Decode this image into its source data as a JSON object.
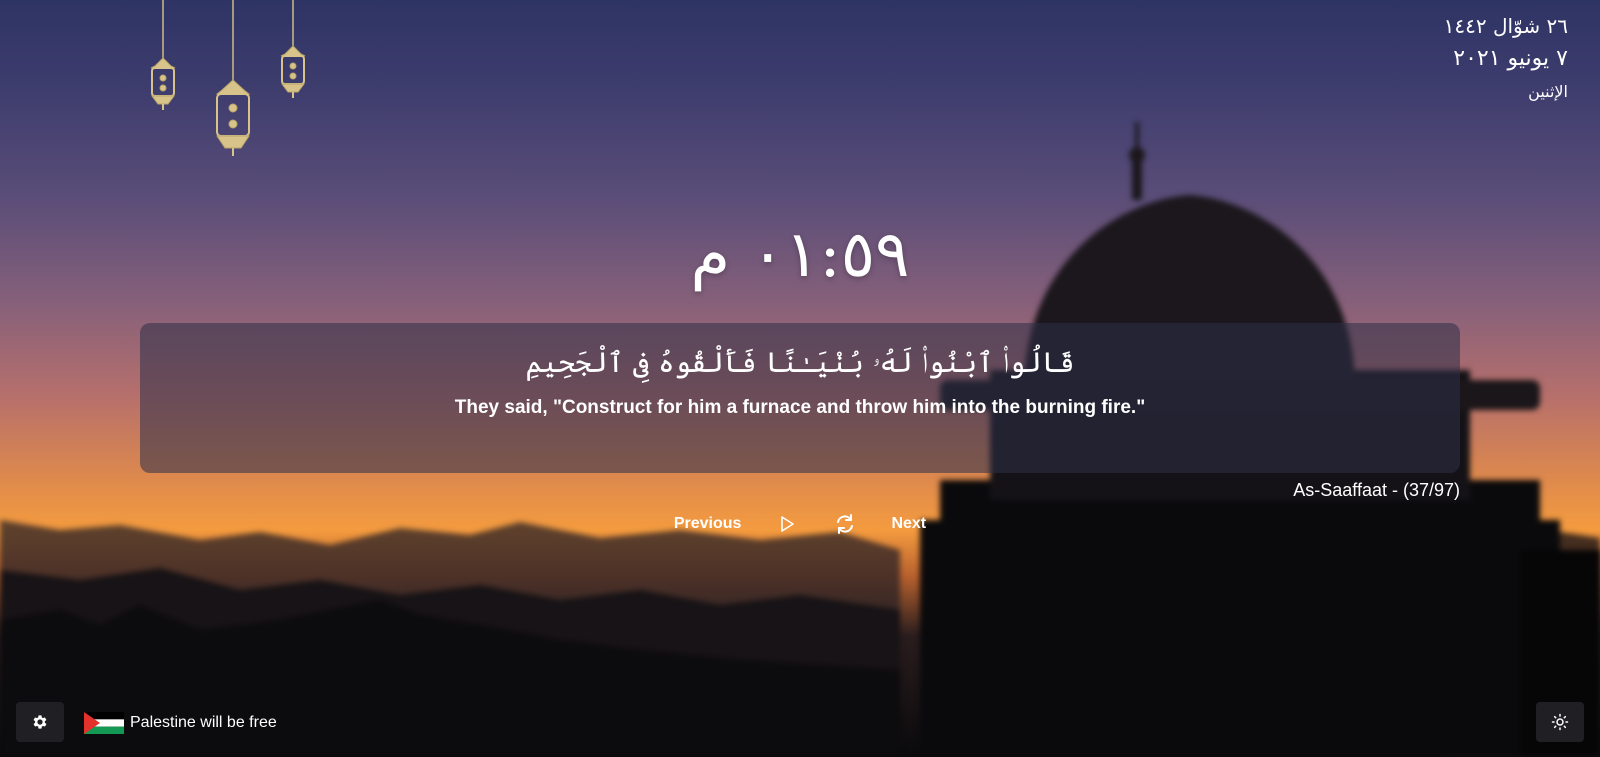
{
  "date": {
    "hijri": "٢٦ شوّال ١٤٤٢",
    "gregorian": "٧ يونيو ٢٠٢١",
    "weekday": "الإثنين"
  },
  "clock": {
    "time": "٠١:٥٩ م"
  },
  "verse": {
    "arabic": "قَالُوا۟ ٱبْنُوا۟ لَهُۥ بُنْيَـٰنًا فَأَلْقُوهُ فِى ٱلْجَحِيمِ",
    "translation": "They said, \"Construct for him a furnace and throw him into the burning fire.\"",
    "reference": "As-Saaffaat - (37/97)"
  },
  "controls": {
    "previous_label": "Previous",
    "next_label": "Next",
    "play_icon": "play-icon",
    "refresh_icon": "refresh-icon"
  },
  "footer": {
    "settings_icon": "gear-icon",
    "palestine_text": "Palestine will be free",
    "theme_icon": "sun-icon"
  },
  "colors": {
    "text": "#ffffff",
    "card_bg": "rgba(45,48,72,0.55)",
    "button_bg": "#202024",
    "lantern": "#d8c48a"
  }
}
